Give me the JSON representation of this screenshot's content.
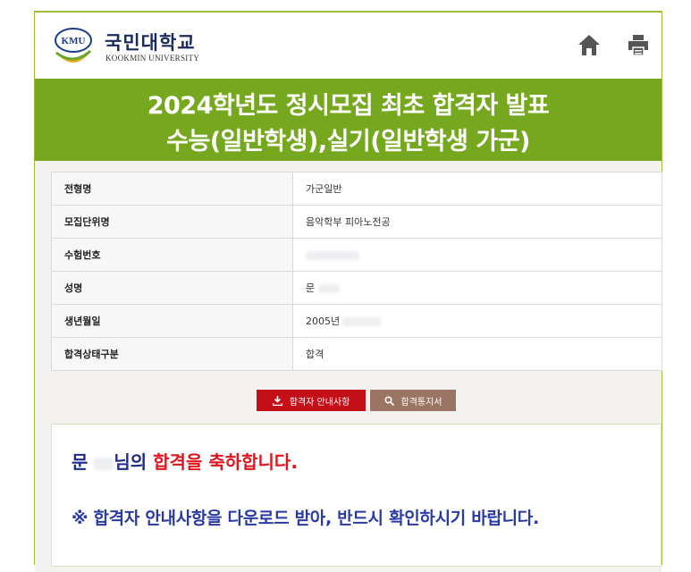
{
  "header": {
    "university_name_kr": "국민대학교",
    "university_name_en": "KOOKMIN UNIVERSITY",
    "emblem_text": "KMU",
    "home_icon": "home-icon",
    "print_icon": "printer-icon"
  },
  "banner": {
    "title_line1": "2024학년도 정시모집 최초 합격자 발표",
    "title_line2": "수능(일반학생),실기(일반학생 가군)"
  },
  "info_table": {
    "rows": [
      {
        "label": "전형명",
        "value": "가군일반"
      },
      {
        "label": "모집단위명",
        "value": "음악학부 피아노전공"
      },
      {
        "label": "수험번호",
        "value": ""
      },
      {
        "label": "성명",
        "value": "문"
      },
      {
        "label": "생년월일",
        "value": "2005년"
      },
      {
        "label": "합격상태구분",
        "value": "합격"
      }
    ]
  },
  "buttons": {
    "guide_label": "합격자 안내사항",
    "guide_icon": "download-icon",
    "notice_label": "합격통지서",
    "notice_icon": "search-icon"
  },
  "message": {
    "name": "문",
    "suffix": "님의",
    "congrats": "합격을 축하합니다.",
    "notice": "※ 합격자 안내사항을 다운로드 받아, 반드시 확인하시기 바랍니다."
  },
  "colors": {
    "banner_green": "#76a81f",
    "guide_button": "#c40f18",
    "notice_button": "#9a7563",
    "accent_red": "#e0141e",
    "accent_navy": "#1d2a8a"
  }
}
